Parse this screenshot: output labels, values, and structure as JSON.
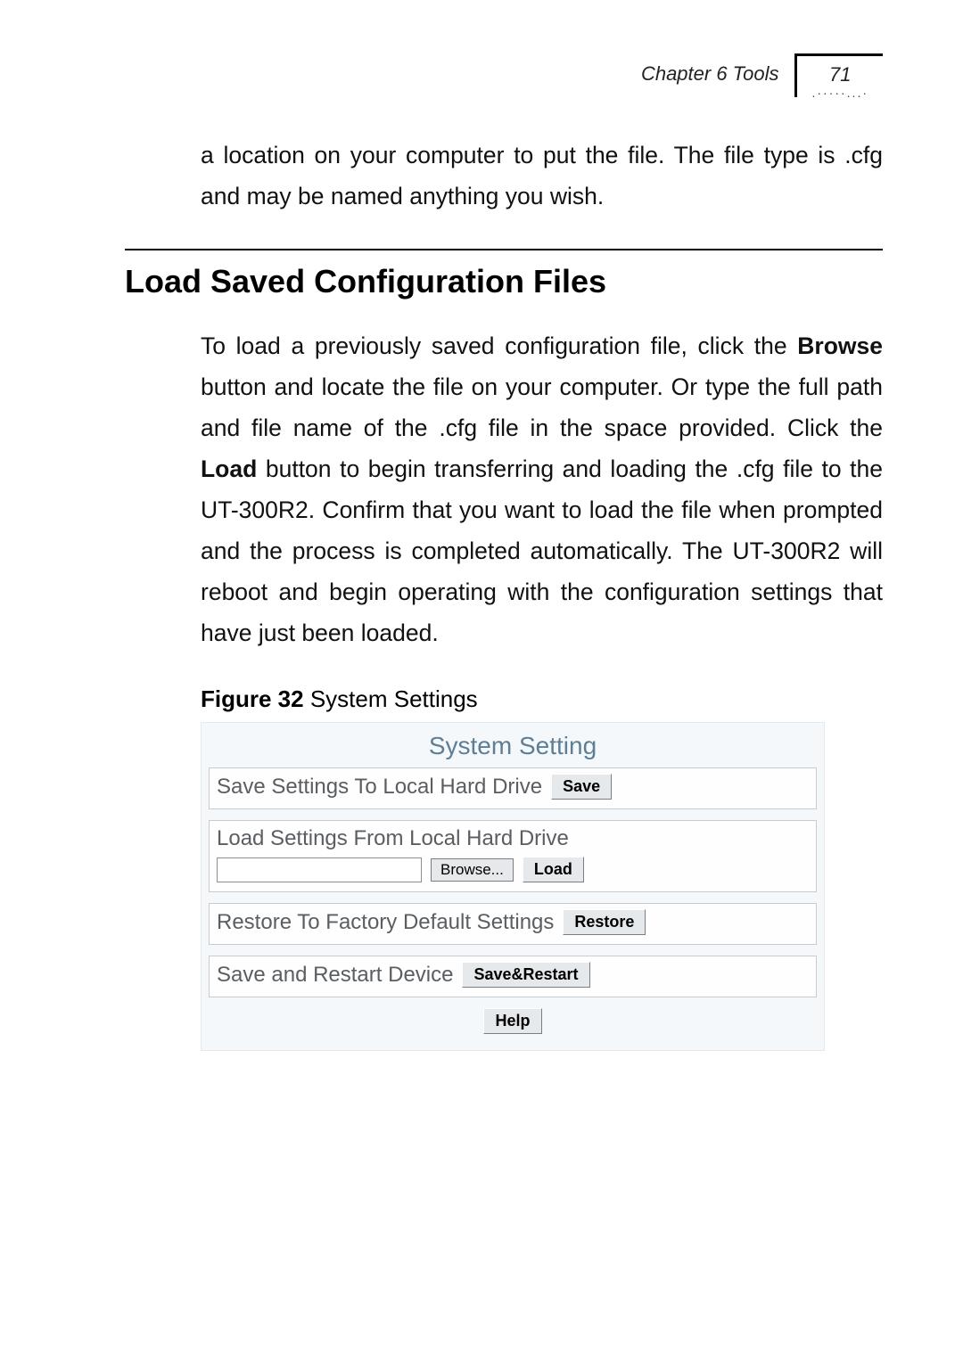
{
  "header": {
    "chapter": "Chapter 6 Tools",
    "page_number": "71",
    "ornament": ".·····...·"
  },
  "intro_paragraph": "a location on your computer to put the file. The file type is .cfg and may be named anything you wish.",
  "section_heading": "Load Saved Configuration Files",
  "main_para_pre": "To load a previously saved configuration file, click the ",
  "main_browse_bold": "Browse",
  "main_para_mid": " button and locate the file on your computer. Or type the full path and file name of the .cfg file in the space provided. Click the ",
  "main_load_bold": "Load",
  "main_para_post": " button to begin transferring and loading the .cfg file to the UT-300R2. Confirm that you want to load the file when prompted and the process is completed automatically. The UT-300R2 will reboot and begin operating with the configuration settings that have just been loaded.",
  "figure_label_bold": "Figure 32",
  "figure_label_rest": " System Settings",
  "system": {
    "title": "System Setting",
    "save_section": {
      "label": "Save Settings To Local Hard Drive",
      "save_btn": "Save"
    },
    "load_section": {
      "label": "Load Settings From Local Hard Drive",
      "browse_btn": "Browse...",
      "load_btn": "Load"
    },
    "restore_section": {
      "label": "Restore To Factory Default Settings",
      "restore_btn": "Restore"
    },
    "restart_section": {
      "label": "Save and Restart Device",
      "restart_btn": "Save&Restart"
    },
    "help_btn": "Help"
  }
}
